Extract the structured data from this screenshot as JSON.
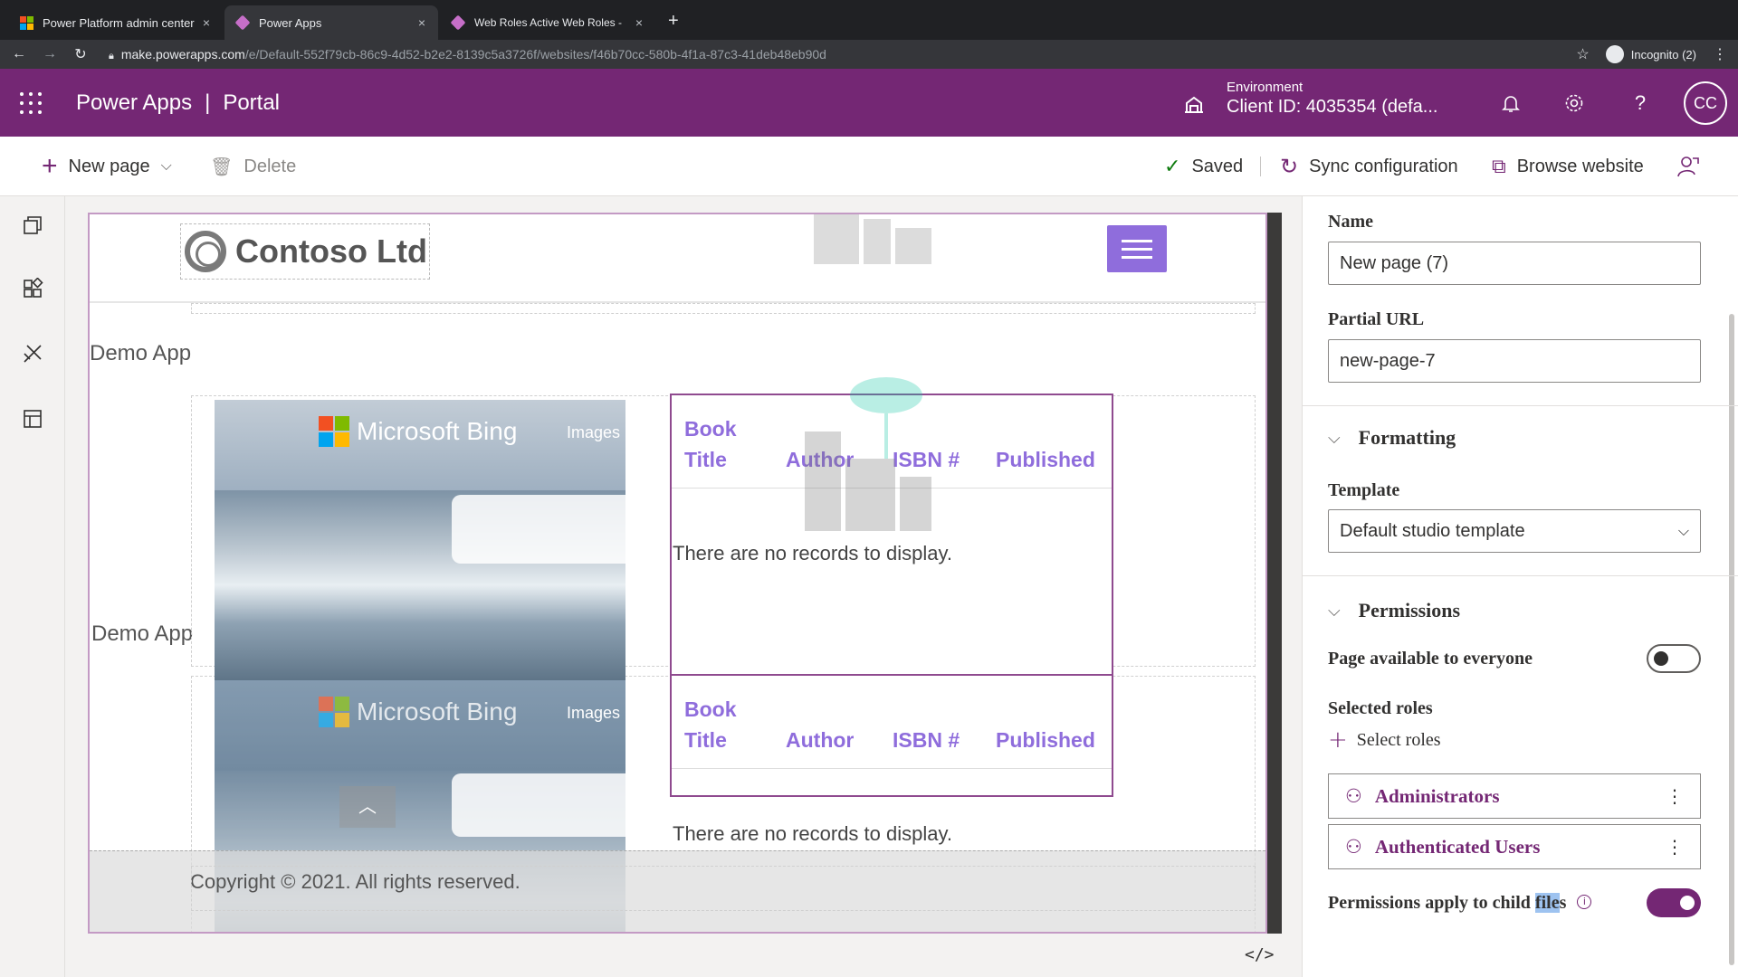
{
  "browser": {
    "tabs": [
      {
        "title": "Power Platform admin center",
        "icon": "microsoft-logo",
        "active": false
      },
      {
        "title": "Power Apps",
        "icon": "power-apps-icon",
        "active": true
      },
      {
        "title": "Web Roles Active Web Roles -",
        "icon": "power-apps-icon",
        "active": false
      }
    ],
    "new_tab": "+",
    "close": "×",
    "url_host": "make.powerapps.com",
    "url_path": "/e/Default-552f79cb-86c9-4d52-b2e2-8139c5a3726f/websites/f46b70cc-580b-4f1a-87c3-41deb48eb90d",
    "profile_label": "Incognito (2)"
  },
  "app": {
    "name": "Power Apps",
    "separator": "|",
    "section": "Portal",
    "env_label": "Environment",
    "env_value": "Client ID: 4035354 (defa...",
    "avatar_initials": "CC",
    "help": "?"
  },
  "commandbar": {
    "new_page": "New page",
    "delete": "Delete",
    "saved": "Saved",
    "sync": "Sync configuration",
    "browse": "Browse website"
  },
  "canvas": {
    "brand": "Contoso Ltd",
    "demo_app_1": "Demo App",
    "demo_app_2": "Demo App",
    "bing_text": "Microsoft Bing",
    "bing_images": "Images",
    "table_headers": [
      "Author",
      "ISBN #",
      "Published"
    ],
    "book_header_line1": "Book",
    "book_header_line2": "Title",
    "no_records": "There are no records to display.",
    "copyright": "Copyright © 2021. All rights reserved.",
    "code_toggle": "</>"
  },
  "panel": {
    "name_label": "Name",
    "name_value": "New page (7)",
    "url_label": "Partial URL",
    "url_value": "new-page-7",
    "formatting_label": "Formatting",
    "template_label": "Template",
    "template_value": "Default studio template",
    "permissions_label": "Permissions",
    "available_label": "Page available to everyone",
    "available_on": false,
    "selected_roles_label": "Selected roles",
    "select_roles": "Select roles",
    "roles": [
      "Administrators",
      "Authenticated Users"
    ],
    "child_files_prefix": "Permissions apply to child ",
    "child_files_highlight": "file",
    "child_files_suffix": "s",
    "child_files_on": true
  },
  "colors": {
    "brand": "#742774",
    "accent_purple": "#8f6ddc",
    "browser_dark": "#202124"
  }
}
